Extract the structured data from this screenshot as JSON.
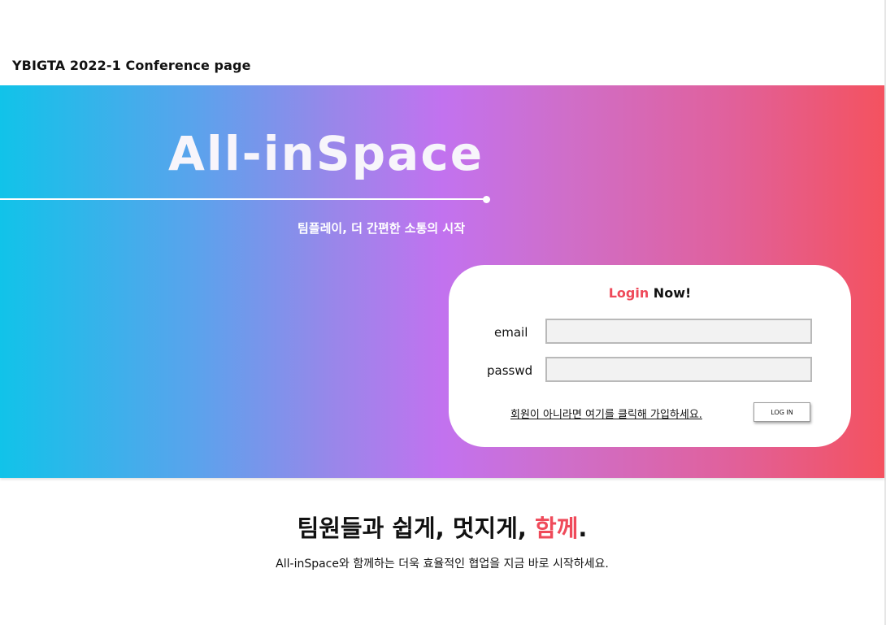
{
  "header": {
    "title": "YBIGTA 2022-1 Conference page"
  },
  "hero": {
    "logo": "All-inSpace",
    "subtitle": "팀플레이, 더 간편한 소통의 시작",
    "gradient_colors": [
      "#11c3e9",
      "#c272ef",
      "#f4525f"
    ]
  },
  "login": {
    "title_accent": "Login",
    "title_rest": " Now!",
    "email_label": "email",
    "email_value": "",
    "passwd_label": "passwd",
    "passwd_value": "",
    "signup_link": "회원이 아니라면 여기를 클릭해 가입하세요.",
    "login_button": "LOG IN",
    "accent_color": "#ef4a5a"
  },
  "tagline": {
    "main_prefix": "팀원들과 쉽게, 멋지게, ",
    "main_accent": "함께",
    "main_suffix": ".",
    "sub": "All-inSpace와 함께하는 더욱 효율적인 협업을 지금 바로 시작하세요."
  }
}
